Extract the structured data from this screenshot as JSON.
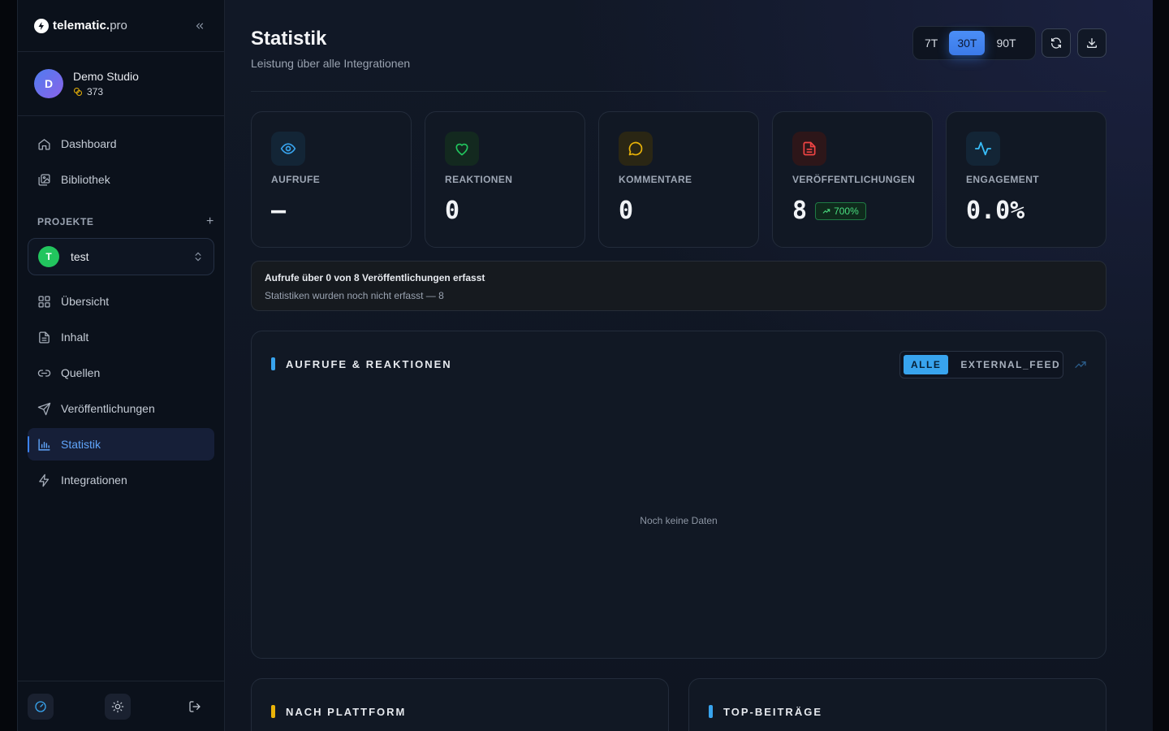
{
  "colors": {
    "accent_blue": "#3b82f6",
    "nav_active_text": "#60a5fa",
    "success_green": "#4ade80",
    "views_icon": "#38a4ee",
    "reactions_icon": "#22c55e",
    "comments_icon": "#eab308",
    "publications_icon": "#ef4444",
    "engagement_icon": "#38bdf8",
    "platform_bar": "#eab308",
    "top_posts_bar": "#38a4ee"
  },
  "brand": {
    "name": "telematic.",
    "suffix": "pro",
    "collapse_icon": "chevrons-left-icon"
  },
  "account": {
    "initial": "D",
    "name": "Demo Studio",
    "credits": "373"
  },
  "nav_top": [
    {
      "label": "Dashboard",
      "icon": "home-icon"
    },
    {
      "label": "Bibliothek",
      "icon": "image-library-icon"
    }
  ],
  "projects": {
    "heading": "PROJEKTE",
    "add": "+",
    "selected": {
      "initial": "T",
      "name": "test"
    }
  },
  "nav_project": [
    {
      "label": "Übersicht",
      "icon": "grid-icon"
    },
    {
      "label": "Inhalt",
      "icon": "document-icon"
    },
    {
      "label": "Quellen",
      "icon": "link-icon"
    },
    {
      "label": "Veröffentlichungen",
      "icon": "send-icon"
    },
    {
      "label": "Statistik",
      "icon": "bar-chart-icon",
      "active": true
    },
    {
      "label": "Integrationen",
      "icon": "bolt-icon"
    }
  ],
  "page": {
    "title": "Statistik",
    "subtitle": "Leistung über alle Integrationen"
  },
  "range": {
    "options": [
      "7T",
      "30T",
      "90T"
    ],
    "selected": "30T"
  },
  "kpis": [
    {
      "key": "views",
      "label": "AUFRUFE",
      "value": "—",
      "icon": "eye-icon"
    },
    {
      "key": "reactions",
      "label": "REAKTIONEN",
      "value": "0",
      "icon": "heart-icon"
    },
    {
      "key": "comments",
      "label": "KOMMENTARE",
      "value": "0",
      "icon": "comment-icon"
    },
    {
      "key": "publications",
      "label": "VERÖFFENTLICHUNGEN",
      "value": "8",
      "badge": "700%",
      "icon": "file-text-icon"
    },
    {
      "key": "engagement",
      "label": "ENGAGEMENT",
      "value": "0.0%",
      "icon": "activity-icon"
    }
  ],
  "notice": {
    "title": "Aufrufe über 0 von 8 Veröffentlichungen erfasst",
    "subtitle": "Statistiken wurden noch nicht erfasst — 8"
  },
  "chart_card": {
    "title": "AUFRUFE & REAKTIONEN",
    "filters": [
      "ALLE",
      "EXTERNAL_FEED"
    ],
    "selected_filter": "ALLE",
    "empty": "Noch keine Daten"
  },
  "bottom_cards": {
    "platform_title": "NACH PLATTFORM",
    "top_posts_title": "TOP-BEITRÄGE"
  }
}
